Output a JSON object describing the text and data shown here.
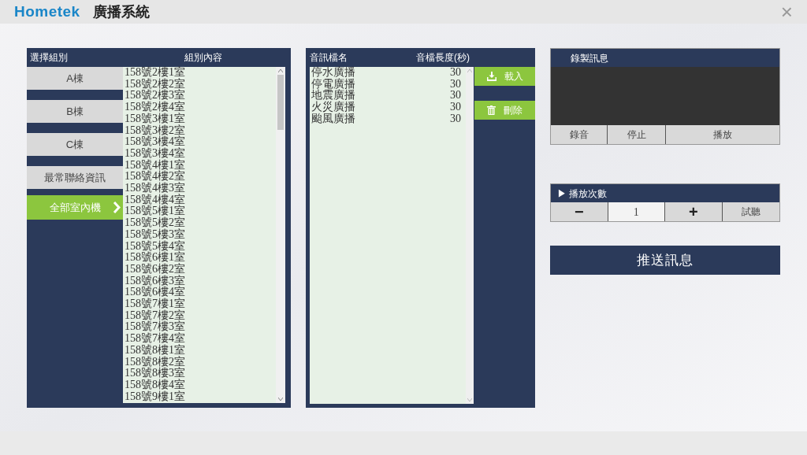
{
  "app": {
    "brand": "Hometek",
    "title": "廣播系統",
    "close": "×"
  },
  "groups": {
    "header": "選擇組別",
    "content_header": "組別內容",
    "items": [
      {
        "label": "A棟",
        "selected": false
      },
      {
        "label": "B棟",
        "selected": false
      },
      {
        "label": "C棟",
        "selected": false
      },
      {
        "label": "最常聯絡資訊",
        "selected": false
      },
      {
        "label": "全部室內機",
        "selected": true
      }
    ],
    "members": [
      "158號2樓1室",
      "158號2樓2室",
      "158號2樓3室",
      "158號2樓4室",
      "158號3樓1室",
      "158號3樓2室",
      "158號3樓4室",
      "158號3樓4室",
      "158號4樓1室",
      "158號4樓2室",
      "158號4樓3室",
      "158號4樓4室",
      "158號5樓1室",
      "158號5樓2室",
      "158號5樓3室",
      "158號5樓4室",
      "158號6樓1室",
      "158號6樓2室",
      "158號6樓3室",
      "158號6樓4室",
      "158號7樓1室",
      "158號7樓2室",
      "158號7樓3室",
      "158號7樓4室",
      "158號8樓1室",
      "158號8樓2室",
      "158號8樓3室",
      "158號8樓4室",
      "158號9樓1室"
    ]
  },
  "audio": {
    "columns": [
      "音訊檔名",
      "音檔長度(秒)"
    ],
    "rows": [
      {
        "name": "停水廣播",
        "length": "30"
      },
      {
        "name": "停電廣播",
        "length": "30"
      },
      {
        "name": "地震廣播",
        "length": "30"
      },
      {
        "name": "火災廣播",
        "length": "30"
      },
      {
        "name": "颱風廣播",
        "length": "30"
      }
    ],
    "actions": [
      {
        "kind": "load",
        "label": "載入"
      },
      {
        "kind": "delete",
        "label": "刪除"
      }
    ]
  },
  "recording": {
    "title": "錄製訊息",
    "buttons": [
      "錄音",
      "停止",
      "播放"
    ]
  },
  "playback": {
    "title": "▶ 播放次數",
    "minus": "−",
    "count": "1",
    "plus": "+",
    "preview": "試聽"
  },
  "send": "推送訊息"
}
